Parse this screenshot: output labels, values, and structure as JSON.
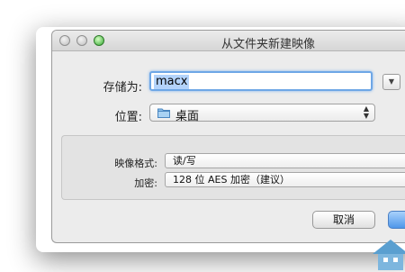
{
  "window": {
    "title": "从文件夹新建映像"
  },
  "save_as": {
    "label": "存储为:",
    "value": "macx"
  },
  "where": {
    "label": "位置:",
    "value": "桌面"
  },
  "options": {
    "format_label": "映像格式:",
    "format_value": "读/写",
    "encryption_label": "加密:",
    "encryption_value": "128 位 AES 加密（建议）"
  },
  "buttons": {
    "cancel": "取消"
  },
  "icons": {
    "expand": "chevron-down-icon",
    "folder": "folder-icon",
    "popup": "updown-arrows-icon"
  },
  "colors": {
    "accent": "#6ea7e6",
    "selection": "#b3d3fb",
    "default_button": "#4f97ea"
  }
}
